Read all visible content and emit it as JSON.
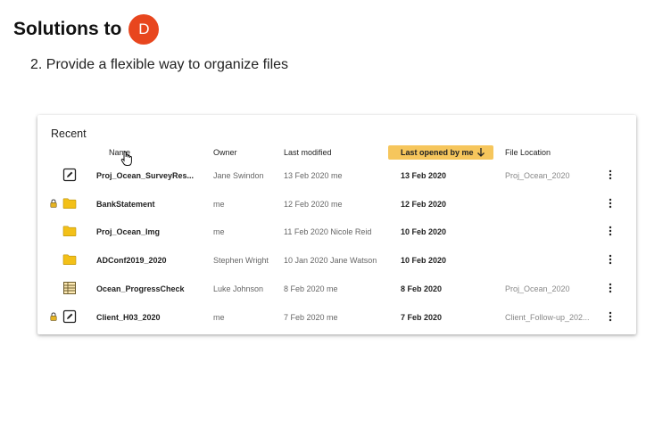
{
  "heading": {
    "text": "Solutions to",
    "badge_letter": "D",
    "badge_color": "#e8461e"
  },
  "subtitle": "2. Provide a flexible way to organize files",
  "recent": {
    "title": "Recent",
    "columns": {
      "name": "Name",
      "owner": "Owner",
      "last_modified": "Last modified",
      "last_opened": "Last opened by me",
      "location": "File Location"
    },
    "sort_icon": "arrow-down-icon",
    "accent_color": "#f6c65c",
    "rows": [
      {
        "icon": "document-edit-icon",
        "locked": false,
        "name": "Proj_Ocean_SurveyRes...",
        "owner": "Jane Swindon",
        "modified": "13 Feb 2020 me",
        "last_opened": "13 Feb 2020",
        "location": "Proj_Ocean_2020"
      },
      {
        "icon": "folder-icon",
        "locked": true,
        "name": "BankStatement",
        "owner": "me",
        "modified": "12 Feb 2020 me",
        "last_opened": "12 Feb 2020",
        "location": ""
      },
      {
        "icon": "folder-icon",
        "locked": false,
        "name": "Proj_Ocean_Img",
        "owner": "me",
        "modified": "11 Feb 2020 Nicole Reid",
        "last_opened": "10 Feb 2020",
        "location": ""
      },
      {
        "icon": "folder-icon",
        "locked": false,
        "name": "ADConf2019_2020",
        "owner": "Stephen Wright",
        "modified": "10 Jan 2020 Jane Watson",
        "last_opened": "10 Feb 2020",
        "location": ""
      },
      {
        "icon": "spreadsheet-icon",
        "locked": false,
        "name": "Ocean_ProgressCheck",
        "owner": "Luke Johnson",
        "modified": "8 Feb 2020 me",
        "last_opened": "8 Feb 2020",
        "location": "Proj_Ocean_2020"
      },
      {
        "icon": "document-edit-icon",
        "locked": true,
        "name": "Client_H03_2020",
        "owner": "me",
        "modified": "7 Feb 2020 me",
        "last_opened": "7 Feb 2020",
        "location": "Client_Follow-up_202..."
      }
    ]
  }
}
